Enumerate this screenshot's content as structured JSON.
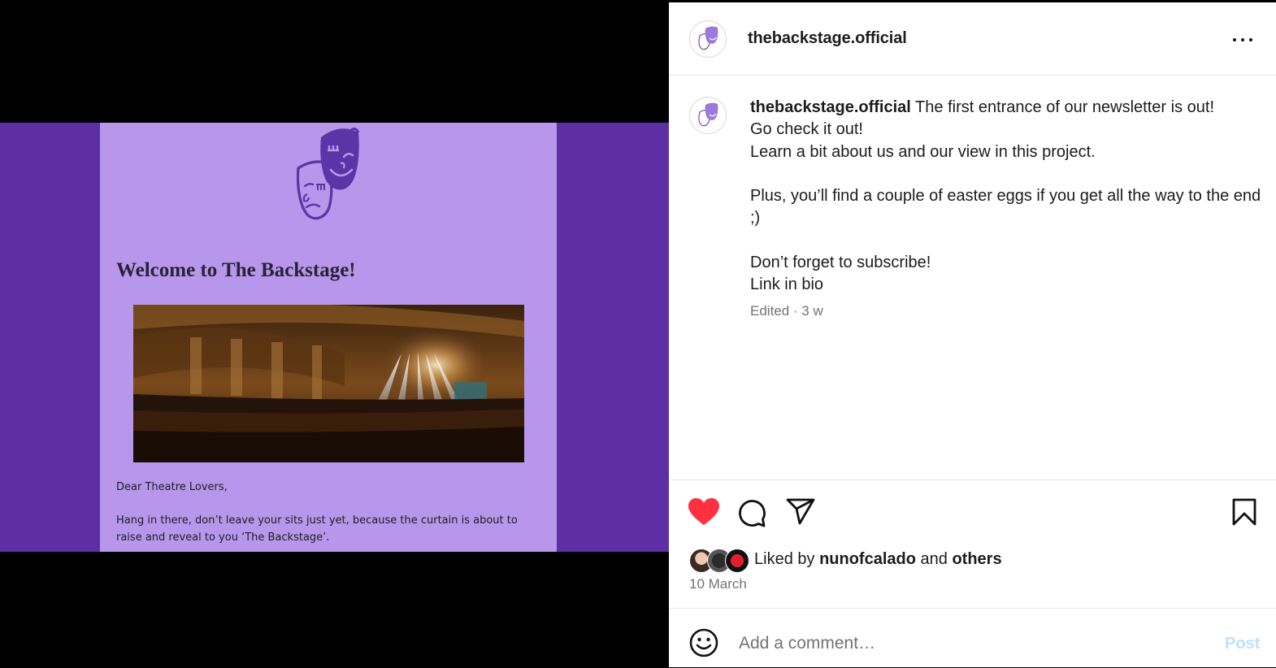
{
  "newsletter": {
    "title": "Welcome to The Backstage!",
    "greeting": "Dear Theatre Lovers,",
    "body": "Hang in there, don’t leave your sits just yet, because the curtain is about to raise and reveal to you ‘The Backstage’."
  },
  "post": {
    "username": "thebackstage.official",
    "caption_lines": [
      "The first entrance of our newsletter is out!",
      "Go check it out!",
      "Learn a bit about us and our view in this project.",
      "Plus, you’ll find a couple of easter eggs if you get all the way to the end ;)",
      "Don’t forget to subscribe!",
      "Link in bio"
    ],
    "meta": "Edited · 3 w",
    "liked_by_prefix": "Liked by",
    "liked_by_user": "nunofcalado",
    "liked_by_and": "and",
    "liked_by_others": "others",
    "date": "10 March"
  },
  "comment": {
    "placeholder": "Add a comment…",
    "post_label": "Post"
  },
  "icons": {
    "more": "more-options-icon",
    "like": "heart-icon",
    "comment": "comment-icon",
    "share": "share-icon",
    "save": "bookmark-icon",
    "emoji": "emoji-icon"
  },
  "colors": {
    "frame_purple": "#5e2fa3",
    "newsletter_lilac": "#b896ec",
    "mask_purple": "#5a35a8",
    "heart_red": "#ff3040",
    "post_disabled": "#c0dffd"
  }
}
